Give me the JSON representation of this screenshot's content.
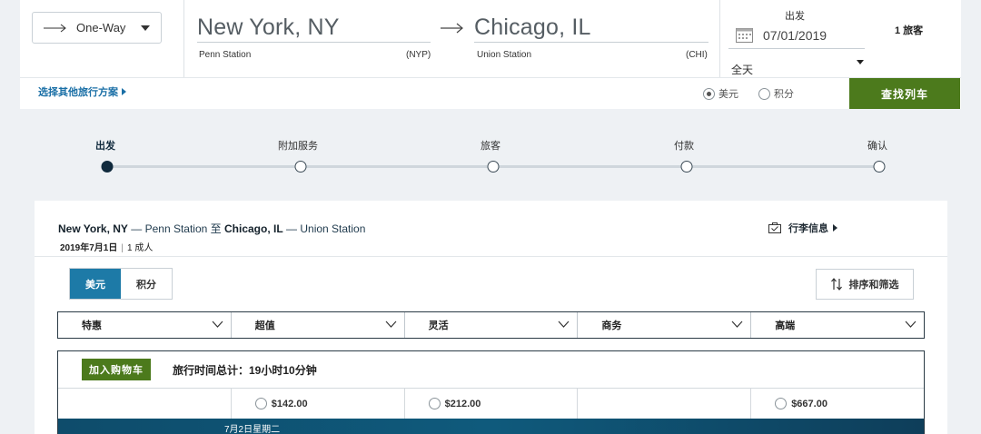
{
  "search": {
    "trip_type": "One-Way",
    "origin": {
      "city": "New York, NY",
      "station": "Penn Station",
      "code": "(NYP)"
    },
    "destination": {
      "city": "Chicago, IL",
      "station": "Union Station",
      "code": "(CHI)"
    },
    "depart_label": "出发",
    "date": "07/01/2019",
    "time": "全天",
    "passengers": "1 旅客",
    "other_plans": "选择其他旅行方案",
    "currency_usd": "美元",
    "currency_points": "积分",
    "find_button": "查找列车"
  },
  "progress": {
    "steps": [
      "出发",
      "附加服务",
      "旅客",
      "付款",
      "确认"
    ],
    "active_index": 0
  },
  "results": {
    "route": {
      "from_city": "New York, NY",
      "from_station": "— Penn Station 至",
      "to_city": "Chicago, IL",
      "to_station": "— Union Station"
    },
    "date_bold": "2019年7月1日",
    "date_sep": "|",
    "travelers": "1 成人",
    "luggage_link": "行李信息",
    "toggle_usd": "美元",
    "toggle_points": "积分",
    "sort_button": "排序和筛选",
    "fare_columns": [
      "特惠",
      "超值",
      "灵活",
      "商务",
      "高端"
    ],
    "train": {
      "add_to_cart": "加入购物车",
      "travel_time": "旅行时间总计：19小时10分钟",
      "prices": [
        "",
        "$142.00",
        "$212.00",
        "",
        "$667.00"
      ],
      "next_date": "7月2日星期二"
    }
  },
  "colors": {
    "brand_green": "#4c7a1c",
    "accent_blue": "#1d7aa7",
    "link_blue": "#1a6fa6",
    "dark_navy": "#102a3d"
  }
}
